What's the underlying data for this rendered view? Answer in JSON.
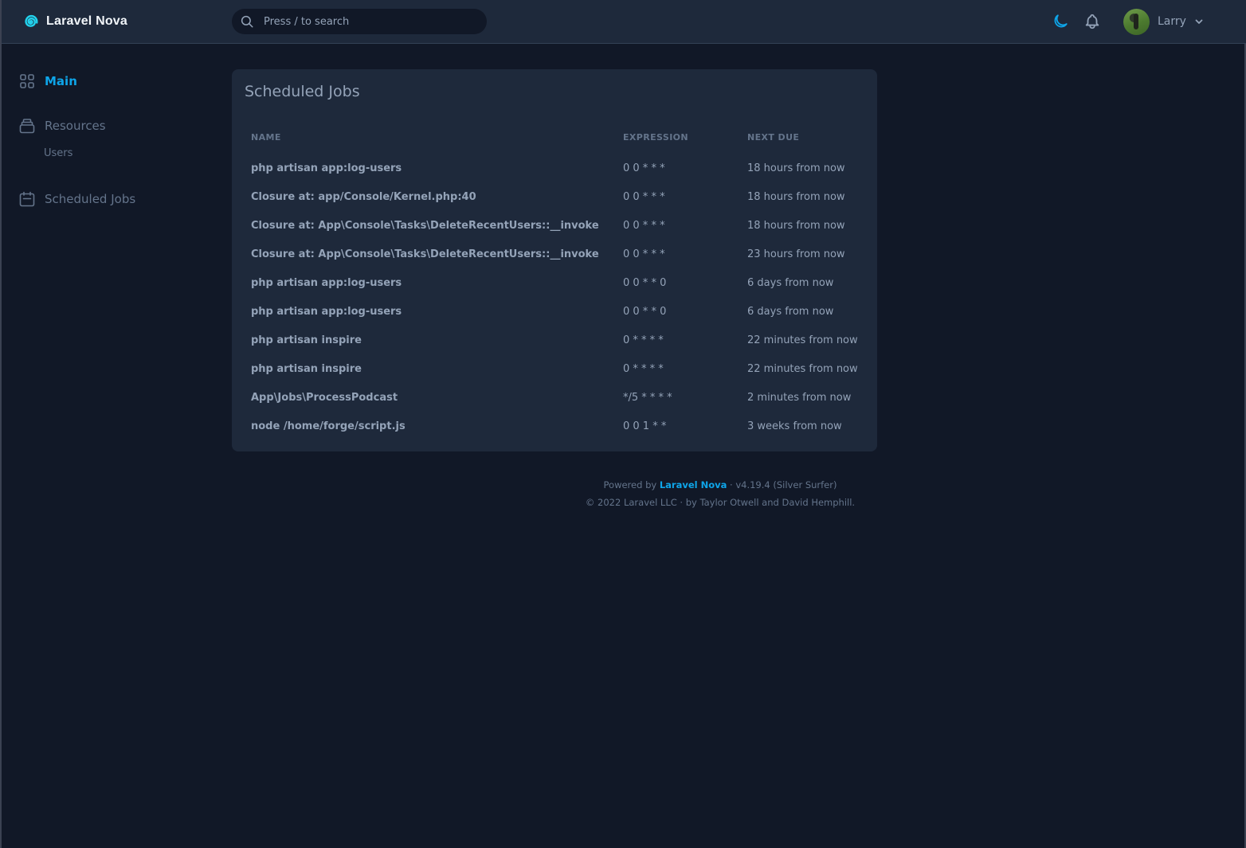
{
  "header": {
    "brand": "Laravel Nova",
    "search_placeholder": "Press / to search",
    "theme_icon": "moon-icon",
    "notifications_icon": "bell-icon",
    "user_name": "Larry"
  },
  "sidebar": {
    "items": [
      {
        "label": "Main",
        "icon": "grid-icon",
        "active": true
      },
      {
        "label": "Resources",
        "icon": "archive-icon",
        "children": [
          {
            "label": "Users"
          }
        ]
      },
      {
        "label": "Scheduled Jobs",
        "icon": "calendar-icon"
      }
    ]
  },
  "card": {
    "title": "Scheduled Jobs",
    "columns": [
      "NAME",
      "EXPRESSION",
      "NEXT DUE"
    ],
    "rows": [
      {
        "name": "php artisan app:log-users",
        "expression": "0 0 * * *",
        "next_due": "18 hours from now"
      },
      {
        "name": "Closure at: app/Console/Kernel.php:40",
        "expression": "0 0 * * *",
        "next_due": "18 hours from now"
      },
      {
        "name": "Closure at: App\\Console\\Tasks\\DeleteRecentUsers::__invoke",
        "expression": "0 0 * * *",
        "next_due": "18 hours from now"
      },
      {
        "name": "Closure at: App\\Console\\Tasks\\DeleteRecentUsers::__invoke",
        "expression": "0 0 * * *",
        "next_due": "23 hours from now"
      },
      {
        "name": "php artisan app:log-users",
        "expression": "0 0 * * 0",
        "next_due": "6 days from now"
      },
      {
        "name": "php artisan app:log-users",
        "expression": "0 0 * * 0",
        "next_due": "6 days from now"
      },
      {
        "name": "php artisan inspire",
        "expression": "0 * * * *",
        "next_due": "22 minutes from now"
      },
      {
        "name": "php artisan inspire",
        "expression": "0 * * * *",
        "next_due": "22 minutes from now"
      },
      {
        "name": "App\\Jobs\\ProcessPodcast",
        "expression": "*/5 * * * *",
        "next_due": "2 minutes from now"
      },
      {
        "name": "node /home/forge/script.js",
        "expression": "0 0 1 * *",
        "next_due": "3 weeks from now"
      }
    ]
  },
  "footer": {
    "powered_by": "Powered by",
    "link": "Laravel Nova",
    "version": "· v4.19.4 (Silver Surfer)",
    "copyright": "© 2022 Laravel LLC · by Taylor Otwell and David Hemphill."
  },
  "colors": {
    "accent": "#0ea5e9",
    "logo": "#22d3ee",
    "background": "#111827",
    "surface": "#1e293b"
  }
}
